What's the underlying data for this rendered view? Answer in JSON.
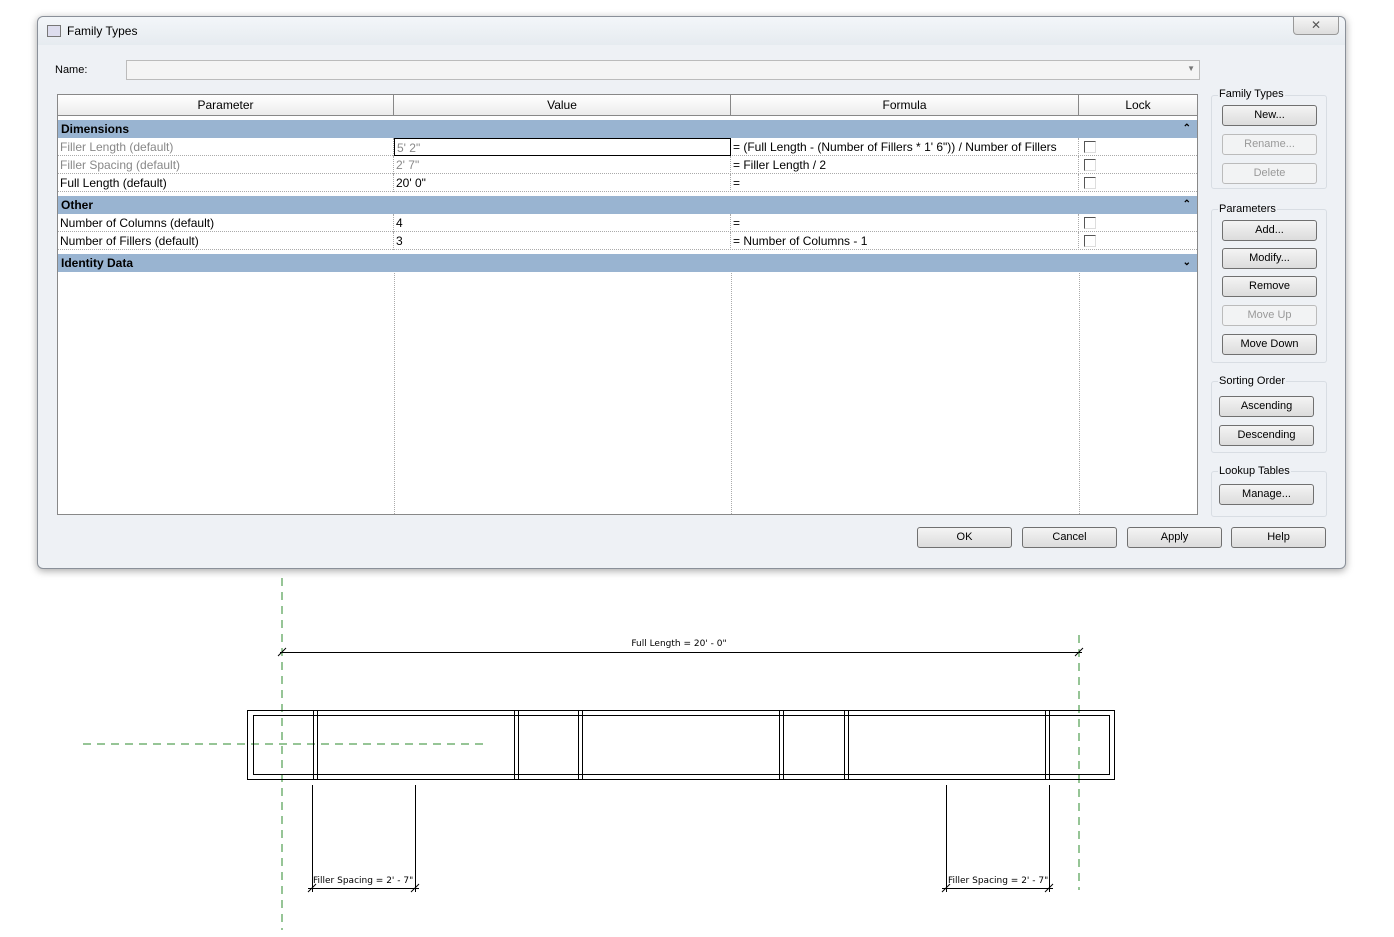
{
  "window": {
    "title": "Family Types",
    "close_label": "✕"
  },
  "name_field": {
    "label": "Name:",
    "value": ""
  },
  "table": {
    "columns": [
      "Parameter",
      "Value",
      "Formula",
      "Lock"
    ],
    "groups": [
      {
        "name": "Dimensions",
        "chevron": "⌃",
        "rows": [
          {
            "parameter": "Filler Length (default)",
            "value": "5'  2\"",
            "formula": "= (Full Length - (Number of Fillers * 1'  6\")) / Number of Fillers",
            "lock": false,
            "readonly": true
          },
          {
            "parameter": "Filler Spacing (default)",
            "value": "2'  7\"",
            "formula": "= Filler Length / 2",
            "lock": false,
            "readonly": true
          },
          {
            "parameter": "Full Length (default)",
            "value": "20'  0\"",
            "formula": "=",
            "lock": false,
            "readonly": false
          }
        ]
      },
      {
        "name": "Other",
        "chevron": "⌃",
        "rows": [
          {
            "parameter": "Number of Columns (default)",
            "value": "4",
            "formula": "=",
            "lock": false,
            "readonly": false
          },
          {
            "parameter": "Number of Fillers (default)",
            "value": "3",
            "formula": "= Number of Columns - 1",
            "lock": false,
            "readonly": false
          }
        ]
      },
      {
        "name": "Identity Data",
        "chevron": "⌄",
        "rows": []
      }
    ]
  },
  "side": {
    "family_types": {
      "title": "Family Types",
      "new": "New...",
      "rename": "Rename...",
      "delete": "Delete"
    },
    "parameters": {
      "title": "Parameters",
      "add": "Add...",
      "modify": "Modify...",
      "remove": "Remove",
      "move_up": "Move Up",
      "move_down": "Move Down"
    },
    "sorting": {
      "title": "Sorting Order",
      "ascending": "Ascending",
      "descending": "Descending"
    },
    "lookup": {
      "title": "Lookup Tables",
      "manage": "Manage..."
    }
  },
  "footer": {
    "ok": "OK",
    "cancel": "Cancel",
    "apply": "Apply",
    "help": "Help"
  },
  "drawing": {
    "full_length": "Full Length = 20' - 0\"",
    "filler_spacing_left": "Filler Spacing = 2' - 7\"",
    "filler_spacing_right": "Filler Spacing = 2' - 7\"",
    "ref_color": "#2e8b2e"
  }
}
